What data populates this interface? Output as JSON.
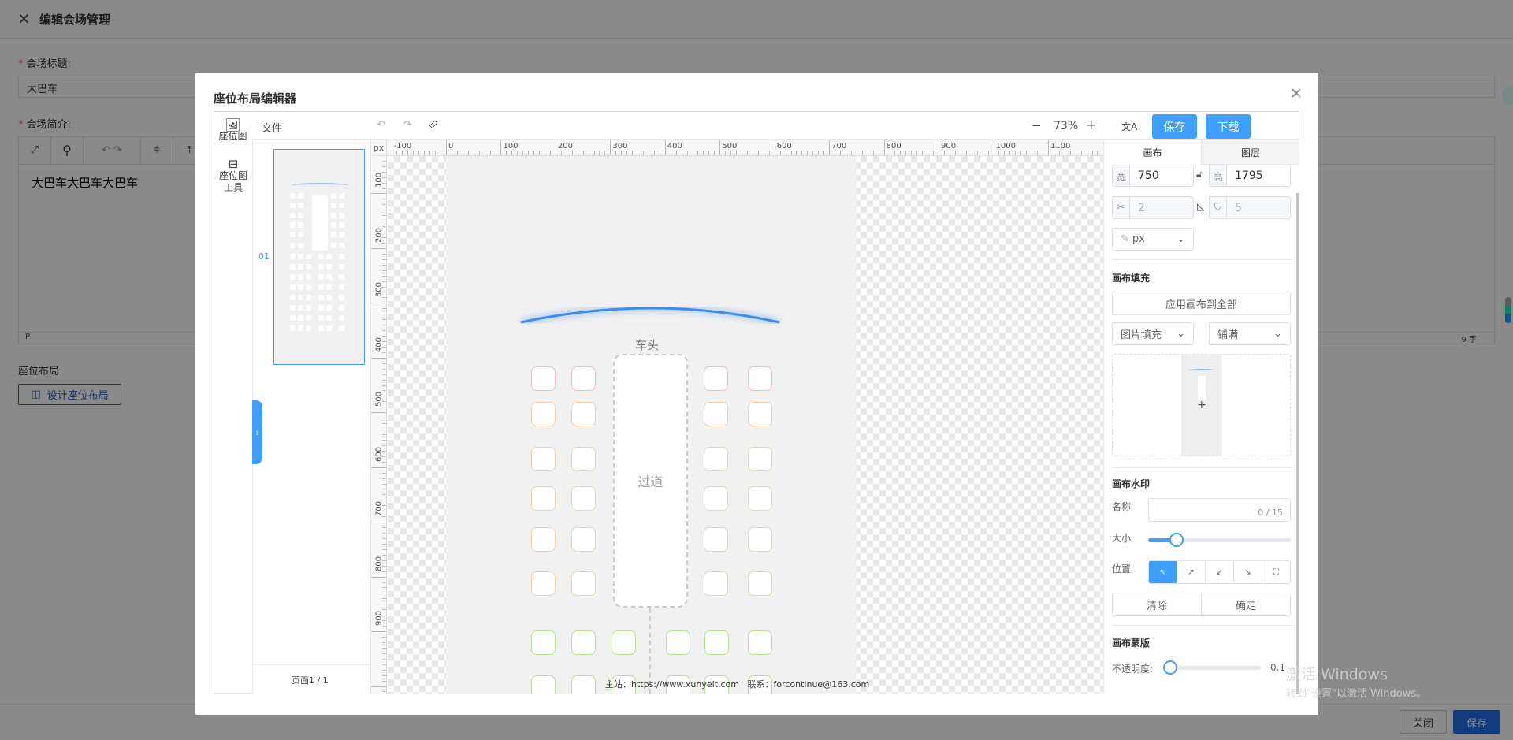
{
  "page": {
    "title": "编辑会场管理",
    "venue_title_label": "会场标题:",
    "venue_title_value": "大巴车",
    "venue_intro_label": "会场简介:",
    "venue_intro_content": "大巴车大巴车大巴车",
    "editor_status_path": "P",
    "editor_word_count": "9 字",
    "seat_layout_label": "座位布局",
    "design_button": "设计座位布局",
    "close_button": "关闭",
    "save_button": "保存"
  },
  "modal": {
    "title": "座位布局编辑器",
    "side_tools": [
      {
        "label": "座位图",
        "icon": "image-icon"
      },
      {
        "label": "座位图工具",
        "icon": "toolbox-icon"
      }
    ],
    "menu_file": "文件",
    "zoom_level": "73%",
    "save": "保存",
    "download": "下载",
    "page_number": "01",
    "page_indicator": "页面1 / 1",
    "ruler_unit": "px",
    "ruler_h_labels": [
      "-100",
      "0",
      "100",
      "200",
      "300",
      "400",
      "500",
      "600",
      "700",
      "800",
      "900",
      "1000",
      "1100"
    ],
    "ruler_v_labels": [
      "100",
      "200",
      "300",
      "400",
      "500",
      "600",
      "700",
      "800",
      "900"
    ],
    "canvas": {
      "front_label": "车头",
      "aisle_label": "过道",
      "footer": "主站：https://www.xunyeit.com   联系：forcontinue@163.com",
      "seat_colors": {
        "first": "#f7b9c2",
        "middle": "#f9cfa3",
        "back": "#b8e08f"
      },
      "arc_color": "#3b8cf0"
    },
    "panel": {
      "tabs": [
        "画布",
        "图层"
      ],
      "active_tab": "画布",
      "width_label": "宽",
      "width": "750",
      "height_label": "高",
      "height": "1795",
      "field_a": "2",
      "field_b": "5",
      "unit": "px",
      "fill_heading": "画布填充",
      "apply_all": "应用画布到全部",
      "fill_type": "图片填充",
      "fill_mode": "铺满",
      "watermark_heading": "画布水印",
      "name_label": "名称",
      "name_counter": "0 / 15",
      "size_label": "大小",
      "size_slider": 0.2,
      "position_label": "位置",
      "position_options": [
        "↖",
        "↗",
        "↙",
        "↘",
        "⛶"
      ],
      "active_position": 0,
      "clear": "清除",
      "confirm": "确定",
      "mask_heading": "画布蒙版",
      "opacity_label": "不透明度:",
      "opacity_value": "0.1"
    }
  },
  "os_watermark": {
    "line1": "激活 Windows",
    "line2": "转到\"设置\"以激活 Windows。"
  },
  "accent_color": "#409eff"
}
